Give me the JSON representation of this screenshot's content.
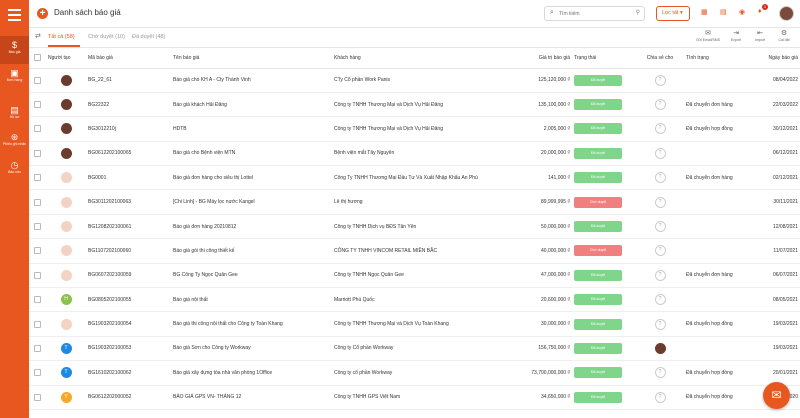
{
  "colors": {
    "accent": "#e8571f",
    "approved": "#7fd68a",
    "rejected": "#f08080"
  },
  "sidebar": {
    "items": [
      {
        "label": "Báo giá",
        "icon": "dollar-icon"
      },
      {
        "label": "Đơn hàng",
        "icon": "receipt-icon"
      },
      {
        "label": "Hồ sơ",
        "icon": "document-icon"
      },
      {
        "label": "Phiếu ghi nhận",
        "icon": "support-icon"
      },
      {
        "label": "Báo cáo",
        "icon": "clock-icon"
      }
    ]
  },
  "header": {
    "title": "Danh sách báo giá",
    "search_placeholder": "Tìm kiếm",
    "filter_label": "Lọc tất",
    "notif_count": "1"
  },
  "toolbar": {
    "tabs": [
      {
        "label": "Tất cả (58)"
      },
      {
        "label": "Chờ duyệt (10)"
      },
      {
        "label": "Đã duyệt (48)"
      }
    ],
    "actions": [
      {
        "label": "Gửi Email/SMS",
        "icon": "mail-icon"
      },
      {
        "label": "Export",
        "icon": "export-icon"
      },
      {
        "label": "Import",
        "icon": "import-icon"
      },
      {
        "label": "Cài đặt",
        "icon": "gear-icon"
      }
    ]
  },
  "table": {
    "columns": [
      "Người tạo",
      "Mã báo giá",
      "Tên báo giá",
      "Khách hàng",
      "Giá trị báo giá",
      "Trạng thái",
      "Chia sẻ cho",
      "Tình trạng",
      "Ngày báo giá"
    ],
    "rows": [
      {
        "avatar": "photo",
        "code": "BG_22_61",
        "name": "Báo giá cho KH A - Cty Thành Vinh",
        "customer": "CTy Cổ phần Work Panis",
        "value": "125,120,000 ₫",
        "status": "Đã duyệt",
        "status_type": "approved",
        "share": "?",
        "condition": "",
        "date": "08/04/2022"
      },
      {
        "avatar": "photo",
        "code": "BG22322",
        "name": "Báo giá khách Hải Đăng",
        "customer": "Công ty TNHH Thương Mại và Dịch Vụ Hải Đăng",
        "value": "135,100,000 ₫",
        "status": "Đã duyệt",
        "status_type": "approved",
        "share": "?",
        "condition": "Đã chuyển đơn hàng",
        "date": "22/03/2022"
      },
      {
        "avatar": "photo",
        "code": "BG3012210j",
        "name": "HDTB",
        "customer": "Công ty TNHH Thương Mại và Dịch Vụ Hải Đăng",
        "value": "2,005,000 ₫",
        "status": "Đã duyệt",
        "status_type": "approved",
        "share": "?",
        "condition": "Đã chuyển hợp đồng",
        "date": "30/12/2021"
      },
      {
        "avatar": "photo",
        "code": "BG0612202100065",
        "name": "Báo giá cho Bệnh viện MTN",
        "customer": "Bệnh viện mắt Tây Nguyên",
        "value": "20,000,000 ₫",
        "status": "Đã duyệt",
        "status_type": "approved",
        "share": "?",
        "condition": "",
        "date": "06/12/2021"
      },
      {
        "avatar": "logo",
        "code": "BG0001",
        "name": "Báo giá đơn hàng cho siêu thị Lottel",
        "customer": "Công Ty TNHH Thương Mại Đầu Tư Và Xuất Nhập Khẩu An Phú",
        "value": "141,000 ₫",
        "status": "Đã duyệt",
        "status_type": "approved",
        "share": "?",
        "condition": "Đã chuyển đơn hàng",
        "date": "02/12/2021"
      },
      {
        "avatar": "logo",
        "code": "BG3011202100063",
        "name": "[Chi Linh] - BG Máy lọc nước Kangel",
        "customer": "Lê thị hương",
        "value": "89,999,995 ₫",
        "status": "Chờ duyệt",
        "status_type": "rejected",
        "share": "?",
        "condition": "",
        "date": "30/11/2021"
      },
      {
        "avatar": "logo",
        "code": "BG1208202100061",
        "name": "Báo giá đơn hàng 20210812",
        "customer": "Công ty TNHH Dịch vụ BĐS Tân Yên",
        "value": "50,000,000 ₫",
        "status": "Đã duyệt",
        "status_type": "approved",
        "share": "?",
        "condition": "",
        "date": "12/08/2021"
      },
      {
        "avatar": "logo",
        "code": "BG1107202100060",
        "name": "Báo giá gói thi công thiết kế",
        "customer": "CÔNG TY TNHH VINCOM RETAIL MIỀN BẮC",
        "value": "40,000,000 ₫",
        "status": "Chờ duyệt",
        "status_type": "rejected",
        "share": "?",
        "condition": "",
        "date": "11/07/2021"
      },
      {
        "avatar": "logo",
        "code": "BG0607202100059",
        "name": "BG Công Ty Ngọc Quân Gee",
        "customer": "Công ty TNHH Ngọc Quân Gee",
        "value": "47,000,000 ₫",
        "status": "Đã duyệt",
        "status_type": "approved",
        "share": "?",
        "condition": "Đã chuyển đơn hàng",
        "date": "06/07/2021"
      },
      {
        "avatar": "H",
        "code": "BG0805202100055",
        "name": "Báo giá nội thất",
        "customer": "Marriott Phú Quốc",
        "value": "20,600,000 ₫",
        "status": "Đã duyệt",
        "status_type": "approved",
        "share": "?",
        "condition": "",
        "date": "08/05/2021"
      },
      {
        "avatar": "logo",
        "code": "BG1903202100054",
        "name": "Báo giá thi công nội thất cho Công ty Toàn Khang",
        "customer": "Công ty TNHH Thương Mại và Dịch Vụ Toàn Khang",
        "value": "30,000,000 ₫",
        "status": "Đã duyệt",
        "status_type": "approved",
        "share": "?",
        "condition": "Đã chuyển hợp đồng",
        "date": "19/03/2021"
      },
      {
        "avatar": "T",
        "code": "BG1903202100053",
        "name": "Báo giá Sơn cho Công ty Workway",
        "customer": "Công ty Cổ phần Workway",
        "value": "156,750,000 ₫",
        "status": "Đã duyệt",
        "status_type": "approved",
        "share": "photo",
        "condition": "",
        "date": "19/03/2021"
      },
      {
        "avatar": "T",
        "code": "BG1610202100062",
        "name": "Báo giá xây dựng tòa nhà văn phòng 1Office",
        "customer": "Công ty cổ phần Workway",
        "value": "73,700,000,000 ₫",
        "status": "Đã duyệt",
        "status_type": "approved",
        "share": "?",
        "condition": "Đã chuyển hợp đồng",
        "date": "20/01/2021"
      },
      {
        "avatar": "Y",
        "code": "BG0612202000052",
        "name": "BÁO GIÁ GPS VN- THÁNG 12",
        "customer": "Công ty TNHH GPS Việt Nam",
        "value": "34,650,000 ₫",
        "status": "Đã duyệt",
        "status_type": "approved",
        "share": "?",
        "condition": "Đã chuyển hợp đồng",
        "date": "06/12/2020"
      }
    ]
  }
}
